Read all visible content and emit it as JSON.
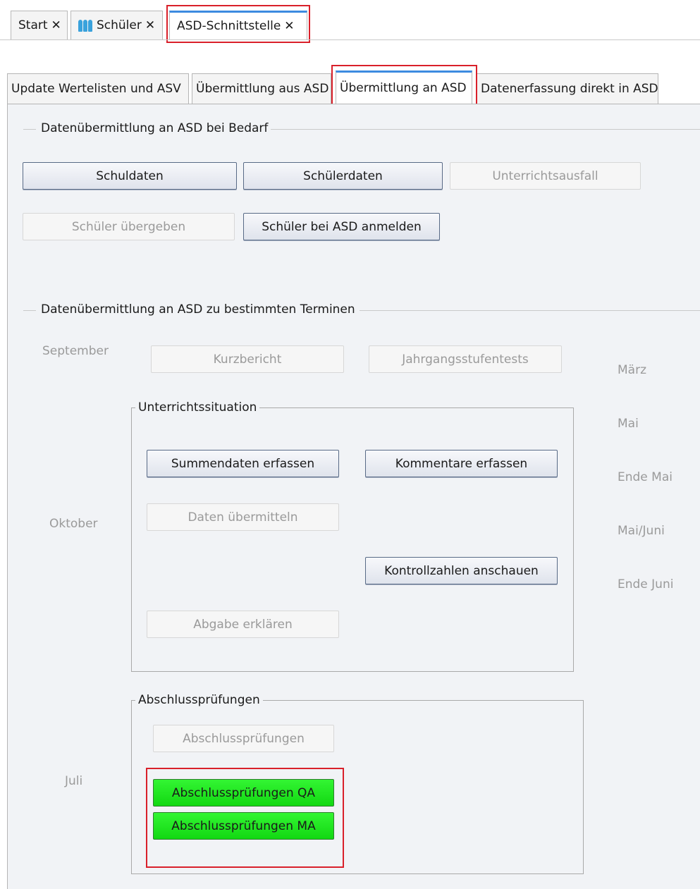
{
  "doc_tabs": [
    {
      "label": "Start"
    },
    {
      "label": "Schüler",
      "icon": "people-icon"
    },
    {
      "label": "ASD-Schnittstelle"
    }
  ],
  "close_glyph": "✕",
  "sub_tabs": [
    {
      "label": "Update Wertelisten und ASV"
    },
    {
      "label": "Übermittlung aus ASD"
    },
    {
      "label": "Übermittlung an ASD"
    },
    {
      "label": "Datenerfassung direkt in ASD"
    }
  ],
  "bedarf": {
    "title": "Datenübermittlung an ASD bei Bedarf",
    "buttons": {
      "schuldaten": "Schuldaten",
      "schuelerdaten": "Schülerdaten",
      "unterrichtsausfall": "Unterrichtsausfall",
      "schueler_uebergeben": "Schüler übergeben",
      "schueler_anmelden": "Schüler bei ASD anmelden"
    }
  },
  "termine": {
    "title": "Datenübermittlung an ASD zu bestimmten Terminen",
    "months_left": {
      "september": "September",
      "oktober": "Oktober",
      "juli": "Juli"
    },
    "months_right": {
      "maerz": "März",
      "mai": "Mai",
      "ende_mai": "Ende Mai",
      "mai_juni": "Mai/Juni",
      "ende_juni": "Ende Juni"
    },
    "kurzbericht": "Kurzbericht",
    "jahrgangsstufentests": "Jahrgangsstufentests",
    "unterrichtssituation": {
      "title": "Unterrichtssituation",
      "summendaten": "Summendaten erfassen",
      "kommentare": "Kommentare erfassen",
      "daten_uebermitteln": "Daten übermitteln",
      "kontrollzahlen": "Kontrollzahlen anschauen",
      "abgabe": "Abgabe erklären"
    },
    "abschluss": {
      "title": "Abschlussprüfungen",
      "abschluss": "Abschlussprüfungen",
      "qa": "Abschlussprüfungen QA",
      "ma": "Abschlussprüfungen MA"
    }
  },
  "colors": {
    "highlight": "#d9202a",
    "green_button": "#22e622",
    "active_tab_accent": "#3d8be0"
  }
}
